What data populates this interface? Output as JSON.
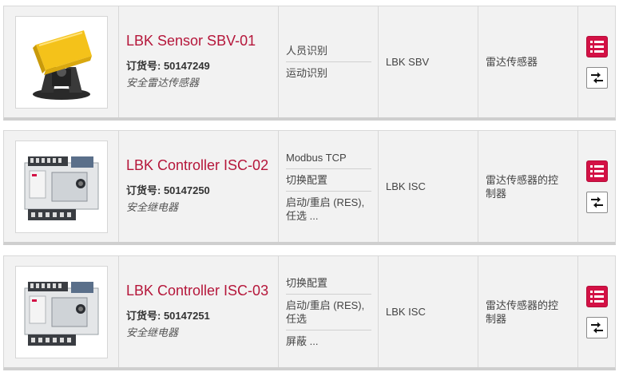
{
  "products": [
    {
      "name": "LBK Sensor SBV-01",
      "order_label": "订货号: 50147249",
      "category": "安全雷达传感器",
      "features": [
        "人员识别",
        "运动识别"
      ],
      "series": "LBK SBV",
      "type": "雷达传感器",
      "image_icon": "radar-sensor-image",
      "list_icon": "list-icon",
      "compare_icon": "compare-arrows-icon"
    },
    {
      "name": "LBK Controller ISC-02",
      "order_label": "订货号: 50147250",
      "category": "安全继电器",
      "features": [
        "Modbus TCP",
        "切换配置",
        "启动/重启 (RES), 任选 ..."
      ],
      "series": "LBK ISC",
      "type": "雷达传感器的控制器",
      "image_icon": "controller-image",
      "list_icon": "list-icon",
      "compare_icon": "compare-arrows-icon"
    },
    {
      "name": "LBK Controller ISC-03",
      "order_label": "订货号: 50147251",
      "category": "安全继电器",
      "features": [
        "切换配置",
        "启动/重启 (RES), 任选",
        "屏蔽 ..."
      ],
      "series": "LBK ISC",
      "type": "雷达传感器的控制器",
      "image_icon": "controller-image",
      "list_icon": "list-icon",
      "compare_icon": "compare-arrows-icon"
    }
  ],
  "colors": {
    "accent": "#b5163a",
    "button_red": "#d31145",
    "row_bg": "#f2f2f2"
  }
}
